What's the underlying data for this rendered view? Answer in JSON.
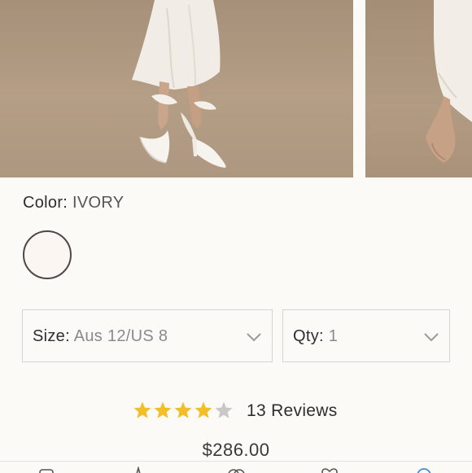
{
  "product": {
    "color_label": "Color:",
    "color_value": "IVORY",
    "swatch_color": "#fbf6f2",
    "size_label": "Size:",
    "size_value": "Aus 12/US 8",
    "qty_label": "Qty:",
    "qty_value": "1",
    "rating": 4,
    "rating_max": 5,
    "reviews_label": "13 Reviews",
    "price": "$286.00"
  },
  "colors": {
    "star_filled": "#f2be2a",
    "star_empty": "#c8c8c8",
    "background": "#fbfaf6"
  },
  "tabbar": {
    "icons": [
      "home-icon",
      "sparkle-icon",
      "likes-icon",
      "heart-icon",
      "account-icon"
    ]
  }
}
